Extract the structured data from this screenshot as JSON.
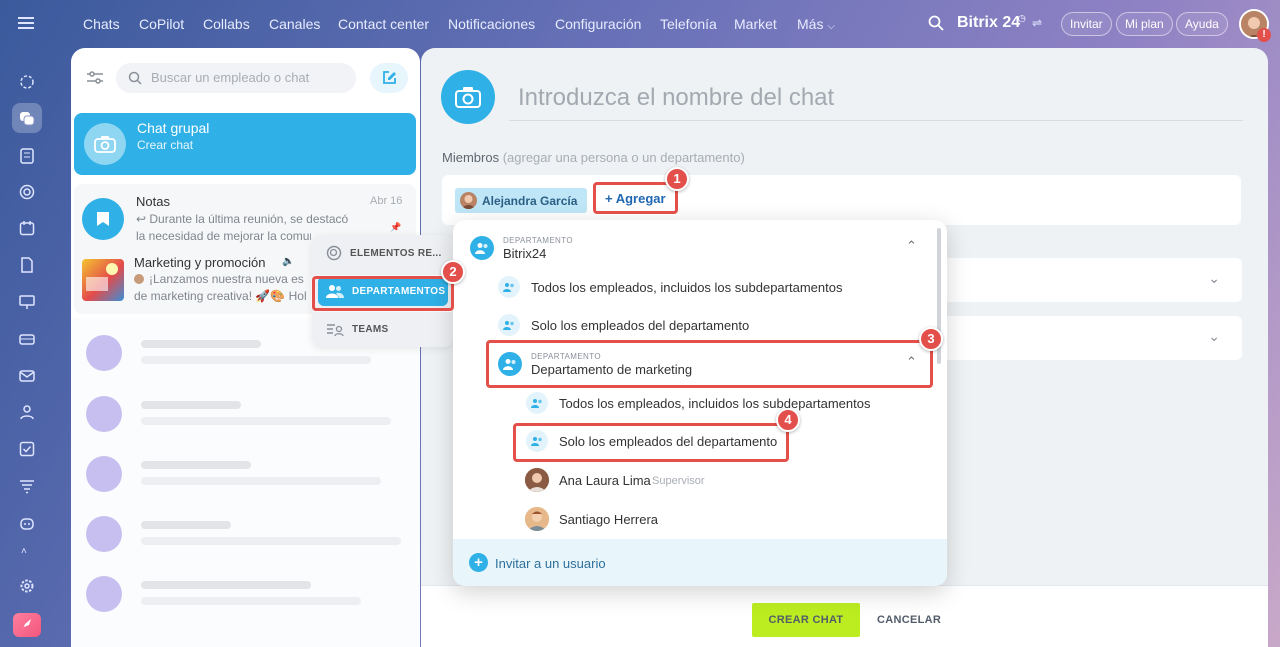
{
  "nav": {
    "items": [
      "Chats",
      "CoPilot",
      "Collabs",
      "Canales",
      "Contact center",
      "Notificaciones",
      "Configuración",
      "Telefonía",
      "Market",
      "Más"
    ],
    "brand": "Bitrix 24",
    "invite": "Invitar",
    "plan": "Mi plan",
    "help": "Ayuda",
    "notification_badge": "!"
  },
  "sidebar_icons": [
    "menu-icon",
    "copilot-icon",
    "chat-icon",
    "feed-icon",
    "target-icon",
    "calendar-icon",
    "document-icon",
    "board-icon",
    "storage-icon",
    "mail-icon",
    "users-icon",
    "tasks-icon",
    "funnel-icon",
    "robot-icon",
    "collapse-icon",
    "settings-icon",
    "rocket-icon"
  ],
  "chat_list": {
    "search_placeholder": "Buscar un empleado o chat",
    "group_chat": {
      "title": "Chat grupal",
      "subtitle": "Crear chat"
    },
    "notes": {
      "title": "Notas",
      "date": "Abr 16",
      "preview1": "↩ Durante la última reunión, se destacó",
      "preview2": "la necesidad de mejorar la comunicació"
    },
    "marketing": {
      "title": "Marketing y promoción",
      "preview1": "¡Lanzamos nuestra nueva es",
      "preview2": "de marketing creativa! 🚀🎨 Hol"
    }
  },
  "submenu": {
    "items": [
      "ELEMENTOS RE...",
      "DEPARTAMENTOS",
      "TEAMS"
    ]
  },
  "main": {
    "chat_name_placeholder": "Introduzca el nombre del chat",
    "members_label": "Miembros",
    "members_hint": "(agregar una persona o un departamento)",
    "member_chip": "Alejandra García",
    "add_label": "+ Agregar",
    "create_label": "CREAR CHAT",
    "cancel_label": "CANCELAR"
  },
  "dropdown": {
    "kicker": "DEPARTAMENTO",
    "dept1": "Bitrix24",
    "all_with_sub": "Todos los empleados, incluidos los subdepartamentos",
    "only_dept": "Solo los empleados del departamento",
    "dept2": "Departamento de marketing",
    "users": [
      {
        "name": "Ana Laura Lima",
        "role": "Supervisor"
      },
      {
        "name": "Santiago Herrera",
        "role": ""
      }
    ],
    "invite": "Invitar a un usuario"
  },
  "annotations": [
    "1",
    "2",
    "3",
    "4"
  ],
  "colors": {
    "accent": "#2fb0e6",
    "highlight": "#e3504b",
    "create_button": "#bbed21"
  }
}
